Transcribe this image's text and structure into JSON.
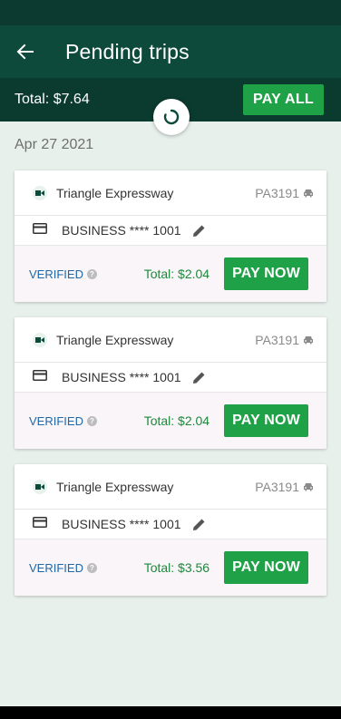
{
  "header": {
    "title": "Pending trips",
    "back_icon": "arrow-left-icon"
  },
  "summary": {
    "total_label": "Total: $7.64",
    "pay_all_label": "PAY ALL"
  },
  "loading_indicator": "refresh-spinner-icon",
  "date_group": "Apr 27 2021",
  "trips": [
    {
      "road": "Triangle Expressway",
      "plate": "PA3191",
      "account": "BUSINESS **** 1001",
      "status": "VERIFIED",
      "total": "Total: $2.04",
      "pay_label": "PAY NOW"
    },
    {
      "road": "Triangle Expressway",
      "plate": "PA3191",
      "account": "BUSINESS **** 1001",
      "status": "VERIFIED",
      "total": "Total: $2.04",
      "pay_label": "PAY NOW"
    },
    {
      "road": "Triangle Expressway",
      "plate": "PA3191",
      "account": "BUSINESS **** 1001",
      "status": "VERIFIED",
      "total": "Total: $3.56",
      "pay_label": "PAY NOW"
    }
  ],
  "colors": {
    "app_bar": "#0d4a3c",
    "status_bar": "#0d3a30",
    "accent_green": "#1fa247",
    "verified_blue": "#1e68a8",
    "total_green": "#1a8a3a",
    "background": "#e8f0ec"
  }
}
